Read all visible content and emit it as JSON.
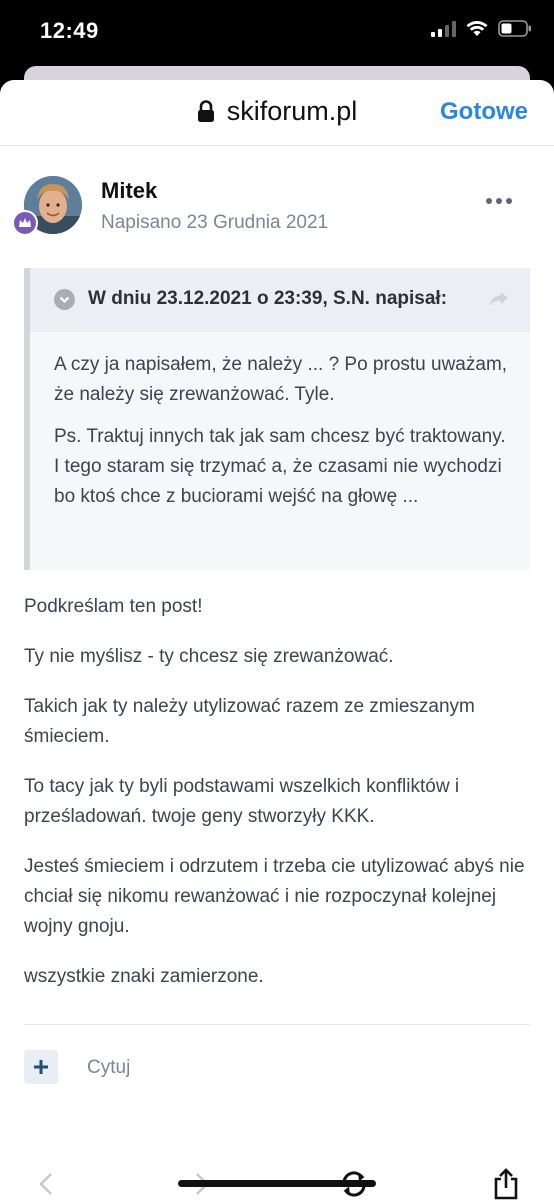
{
  "status_bar": {
    "time": "12:49"
  },
  "nav": {
    "domain": "skiforum.pl",
    "done_label": "Gotowe",
    "icons": [
      "lock-icon"
    ]
  },
  "post": {
    "author": "Mitek",
    "date": "Napisano 23 Grudnia 2021",
    "quote": {
      "citation": "W dniu 23.12.2021 o 23:39, S.N. napisał:",
      "paragraphs": [
        "A czy ja napisałem, że należy ... ? Po prostu uważam, że należy się zrewanżować. Tyle.",
        "Ps. Traktuj innych tak jak sam chcesz być traktowany. I tego staram się trzymać a, że czasami nie wychodzi bo ktoś chce z buciorami wejść na głowę ..."
      ]
    },
    "paragraphs": [
      "Podkreślam ten post!",
      "Ty nie myślisz - ty chcesz się zrewanżować.",
      "Takich jak ty należy utylizować razem ze zmieszanym śmieciem.",
      "To tacy jak ty byli podstawami wszelkich konfliktów i prześladowań. twoje geny stworzyły KKK.",
      "Jesteś śmieciem i odrzutem i trzeba cie utylizować abyś nie chciał się nikomu rewanżować i nie rozpoczynał kolejnej wojny gnoju.",
      "wszystkie znaki zamierzone."
    ],
    "actions": {
      "quote_label": "Cytuj"
    }
  },
  "colors": {
    "accent": "#2a86e0",
    "badge": "#7a5bb8",
    "muted": "#7d8694"
  }
}
